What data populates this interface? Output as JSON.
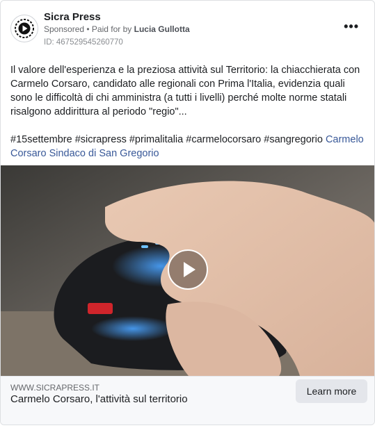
{
  "post": {
    "page_name": "Sicra Press",
    "sponsored": "Sponsored",
    "separator": " • ",
    "paid_for_prefix": "Paid for by ",
    "paid_for_name": "Lucia Gullotta",
    "ad_id": "ID: 467529545260770",
    "more_label": "•••",
    "body": "Il valore dell'esperienza e la preziosa attività sul Territorio: la chiacchierata con Carmelo Corsaro, candidato alle regionali con Prima l'Italia, evidenzia quali sono le difficoltà di chi amministra (a tutti i livelli) perché molte norme statali risalgono addirittura al periodo \"regio\"...",
    "hashtags": "#15settembre #sicrapress #primalitalia #carmelocorsaro #sangregorio ",
    "hashtag_link": "Carmelo Corsaro Sindaco di San Gregorio"
  },
  "footer": {
    "domain": "WWW.SICRAPRESS.IT",
    "headline": "Carmelo Corsaro, l'attività sul territorio",
    "cta_label": "Learn more"
  },
  "colors": {
    "link": "#385898",
    "footer_bg": "#f7f8fa",
    "button_bg": "#e4e6eb"
  },
  "icons": {
    "avatar": "sicra-press-logo",
    "more": "more-options-icon",
    "play": "play-icon"
  }
}
